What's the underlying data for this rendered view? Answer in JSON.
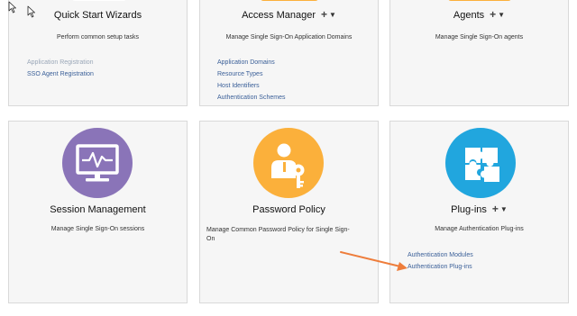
{
  "colors": {
    "purple": "#8a74b8",
    "orange": "#fbb03b",
    "blue": "#21a6de",
    "link": "#3a5f98",
    "muted_link": "#9aa7b8"
  },
  "cards": {
    "quick_start": {
      "title": "Quick Start Wizards",
      "desc": "Perform common setup tasks",
      "links": [
        "Application Registration",
        "SSO Agent Registration"
      ]
    },
    "access_manager": {
      "title": "Access Manager",
      "desc": "Manage Single Sign-On Application Domains",
      "links": [
        "Application Domains",
        "Resource Types",
        "Host Identifiers",
        "Authentication Schemes"
      ]
    },
    "agents": {
      "title": "Agents",
      "desc": "Manage Single Sign-On agents"
    },
    "session_management": {
      "title": "Session Management",
      "desc": "Manage Single Sign-On sessions",
      "icon": "monitor-icon"
    },
    "password_policy": {
      "title": "Password Policy",
      "desc": "Manage Common Password Policy for Single Sign-On",
      "icon": "user-key-icon"
    },
    "plugins": {
      "title": "Plug-ins",
      "desc": "Manage Authentication Plug-ins",
      "links": [
        "Authentication Modules",
        "Authentication Plug-ins"
      ],
      "icon": "puzzle-icon"
    }
  },
  "icons": {
    "plus": "plus-icon",
    "caret": "caret-down-icon",
    "cursor": "mouse-cursor-icon",
    "arrow": "annotation-arrow-icon"
  },
  "glyphs": {
    "plus": "+",
    "caret": "▼"
  }
}
